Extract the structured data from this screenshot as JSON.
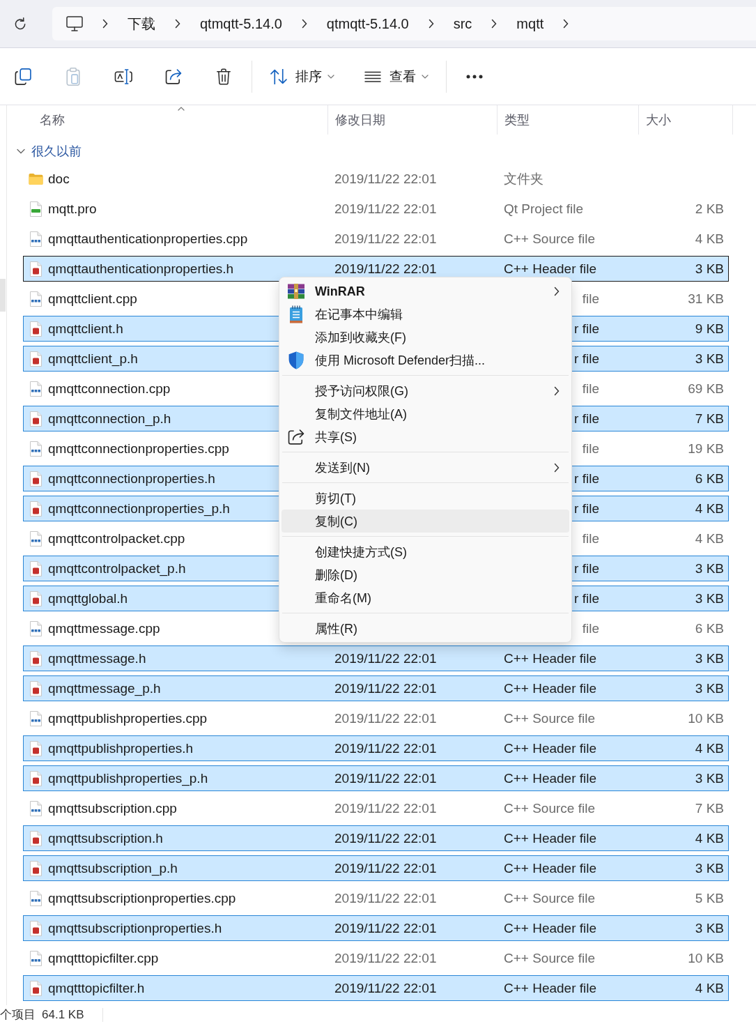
{
  "navigation_bar": {
    "breadcrumbs": [
      "下载",
      "qtmqtt-5.14.0",
      "qtmqtt-5.14.0",
      "src",
      "mqtt"
    ]
  },
  "toolbar": {
    "groups": [
      {
        "buttons": [
          {
            "kind": "copy",
            "disabled": false
          },
          {
            "kind": "paste",
            "disabled": true
          },
          {
            "kind": "rename",
            "disabled": false
          },
          {
            "kind": "share",
            "disabled": false
          },
          {
            "kind": "delete",
            "disabled": false
          }
        ]
      },
      {
        "buttons": [
          {
            "kind": "sort",
            "label": "排序",
            "disabled": false
          },
          {
            "kind": "view",
            "label": "查看",
            "disabled": false
          }
        ]
      },
      {
        "buttons": [
          {
            "kind": "more",
            "disabled": false
          }
        ]
      }
    ]
  },
  "file_list": {
    "columns": [
      {
        "label": "名称",
        "sorted": true
      },
      {
        "label": "修改日期",
        "sorted": false
      },
      {
        "label": "类型",
        "sorted": false
      },
      {
        "label": "大小",
        "sorted": false
      }
    ],
    "groups": [
      {
        "label": "很久以前",
        "expanded": true,
        "rows": [
          {
            "kind": "folder",
            "name": "doc",
            "date": "2019/11/22 22:01",
            "type": "文件夹",
            "selected": false,
            "focused": false
          },
          {
            "kind": "pro",
            "name": "mqtt.pro",
            "date": "2019/11/22 22:01",
            "type": "Qt Project file",
            "size": "2 KB",
            "selected": false,
            "focused": false
          },
          {
            "kind": "cpp",
            "name": "qmqttauthenticationproperties.cpp",
            "date": "2019/11/22 22:01",
            "type": "C++ Source file",
            "size": "4 KB",
            "selected": false,
            "focused": false
          },
          {
            "kind": "h",
            "name": "qmqttauthenticationproperties.h",
            "date": "2019/11/22 22:01",
            "type": "C++ Header file",
            "size": "3 KB",
            "selected": true,
            "focused": true
          },
          {
            "kind": "cpp",
            "name": "qmqttclient.cpp",
            "type": "file",
            "size": "31 KB",
            "selected": false,
            "focused": false
          },
          {
            "kind": "h",
            "name": "qmqttclient.h",
            "type": "r file",
            "size": "9 KB",
            "selected": true,
            "focused": false
          },
          {
            "kind": "h",
            "name": "qmqttclient_p.h",
            "type": "r file",
            "size": "3 KB",
            "selected": true,
            "focused": false
          },
          {
            "kind": "cpp",
            "name": "qmqttconnection.cpp",
            "type": "file",
            "size": "69 KB",
            "selected": false,
            "focused": false
          },
          {
            "kind": "h",
            "name": "qmqttconnection_p.h",
            "type": "r file",
            "size": "7 KB",
            "selected": true,
            "focused": false
          },
          {
            "kind": "cpp",
            "name": "qmqttconnectionproperties.cpp",
            "type": "file",
            "size": "19 KB",
            "selected": false,
            "focused": false
          },
          {
            "kind": "h",
            "name": "qmqttconnectionproperties.h",
            "type": "r file",
            "size": "6 KB",
            "selected": true,
            "focused": false
          },
          {
            "kind": "h",
            "name": "qmqttconnectionproperties_p.h",
            "type": "r file",
            "size": "4 KB",
            "selected": true,
            "focused": false
          },
          {
            "kind": "cpp",
            "name": "qmqttcontrolpacket.cpp",
            "type": "file",
            "size": "4 KB",
            "selected": false,
            "focused": false
          },
          {
            "kind": "h",
            "name": "qmqttcontrolpacket_p.h",
            "type": "r file",
            "size": "3 KB",
            "selected": true,
            "focused": false
          },
          {
            "kind": "h",
            "name": "qmqttglobal.h",
            "type": "r file",
            "size": "3 KB",
            "selected": true,
            "focused": false
          },
          {
            "kind": "cpp",
            "name": "qmqttmessage.cpp",
            "type": "file",
            "size": "6 KB",
            "selected": false,
            "focused": false
          },
          {
            "kind": "h",
            "name": "qmqttmessage.h",
            "date": "2019/11/22 22:01",
            "type": "C++ Header file",
            "size": "3 KB",
            "selected": true,
            "focused": false
          },
          {
            "kind": "h",
            "name": "qmqttmessage_p.h",
            "date": "2019/11/22 22:01",
            "type": "C++ Header file",
            "size": "3 KB",
            "selected": true,
            "focused": false
          },
          {
            "kind": "cpp",
            "name": "qmqttpublishproperties.cpp",
            "date": "2019/11/22 22:01",
            "type": "C++ Source file",
            "size": "10 KB",
            "selected": false,
            "focused": false
          },
          {
            "kind": "h",
            "name": "qmqttpublishproperties.h",
            "date": "2019/11/22 22:01",
            "type": "C++ Header file",
            "size": "4 KB",
            "selected": true,
            "focused": false
          },
          {
            "kind": "h",
            "name": "qmqttpublishproperties_p.h",
            "date": "2019/11/22 22:01",
            "type": "C++ Header file",
            "size": "3 KB",
            "selected": true,
            "focused": false
          },
          {
            "kind": "cpp",
            "name": "qmqttsubscription.cpp",
            "date": "2019/11/22 22:01",
            "type": "C++ Source file",
            "size": "7 KB",
            "selected": false,
            "focused": false
          },
          {
            "kind": "h",
            "name": "qmqttsubscription.h",
            "date": "2019/11/22 22:01",
            "type": "C++ Header file",
            "size": "4 KB",
            "selected": true,
            "focused": false
          },
          {
            "kind": "h",
            "name": "qmqttsubscription_p.h",
            "date": "2019/11/22 22:01",
            "type": "C++ Header file",
            "size": "3 KB",
            "selected": true,
            "focused": false
          },
          {
            "kind": "cpp",
            "name": "qmqttsubscriptionproperties.cpp",
            "date": "2019/11/22 22:01",
            "type": "C++ Source file",
            "size": "5 KB",
            "selected": false,
            "focused": false
          },
          {
            "kind": "h",
            "name": "qmqttsubscriptionproperties.h",
            "date": "2019/11/22 22:01",
            "type": "C++ Header file",
            "size": "3 KB",
            "selected": true,
            "focused": false
          },
          {
            "kind": "cpp",
            "name": "qmqtttopicfilter.cpp",
            "date": "2019/11/22 22:01",
            "type": "C++ Source file",
            "size": "10 KB",
            "selected": false,
            "focused": false
          },
          {
            "kind": "h",
            "name": "qmqtttopicfilter.h",
            "date": "2019/11/22 22:01",
            "type": "C++ Header file",
            "size": "4 KB",
            "selected": true,
            "focused": false
          }
        ]
      }
    ]
  },
  "context_menu": {
    "groups": [
      {
        "items": [
          {
            "kind": "archive",
            "label": "WinRAR",
            "submenu": true,
            "selected": false
          },
          {
            "kind": "notepad",
            "label": "在记事本中编辑",
            "submenu": false,
            "selected": false
          },
          {
            "kind": "plain",
            "label": "添加到收藏夹(F)",
            "submenu": false,
            "selected": false
          },
          {
            "kind": "shield",
            "label": "使用 Microsoft Defender扫描...",
            "submenu": false,
            "selected": false
          }
        ]
      },
      {
        "items": [
          {
            "kind": "plain",
            "label": "授予访问权限(G)",
            "submenu": true,
            "selected": false
          },
          {
            "kind": "plain",
            "label": "复制文件地址(A)",
            "submenu": false,
            "selected": false
          },
          {
            "kind": "share",
            "label": "共享(S)",
            "submenu": false,
            "selected": false
          }
        ]
      },
      {
        "items": [
          {
            "kind": "plain",
            "label": "发送到(N)",
            "submenu": true,
            "selected": false
          }
        ]
      },
      {
        "items": [
          {
            "kind": "plain",
            "label": "剪切(T)",
            "submenu": false,
            "selected": false
          },
          {
            "kind": "plain",
            "label": "复制(C)",
            "submenu": false,
            "selected": true
          }
        ]
      },
      {
        "items": [
          {
            "kind": "plain",
            "label": "创建快捷方式(S)",
            "submenu": false,
            "selected": false
          },
          {
            "kind": "plain",
            "label": "删除(D)",
            "submenu": false,
            "selected": false
          },
          {
            "kind": "plain",
            "label": "重命名(M)",
            "submenu": false,
            "selected": false
          }
        ]
      },
      {
        "items": [
          {
            "kind": "plain",
            "label": "属性(R)",
            "submenu": false,
            "selected": false
          }
        ]
      }
    ]
  },
  "status_bar": {
    "item_count": "个项目",
    "selection_size": "64.1 KB"
  }
}
